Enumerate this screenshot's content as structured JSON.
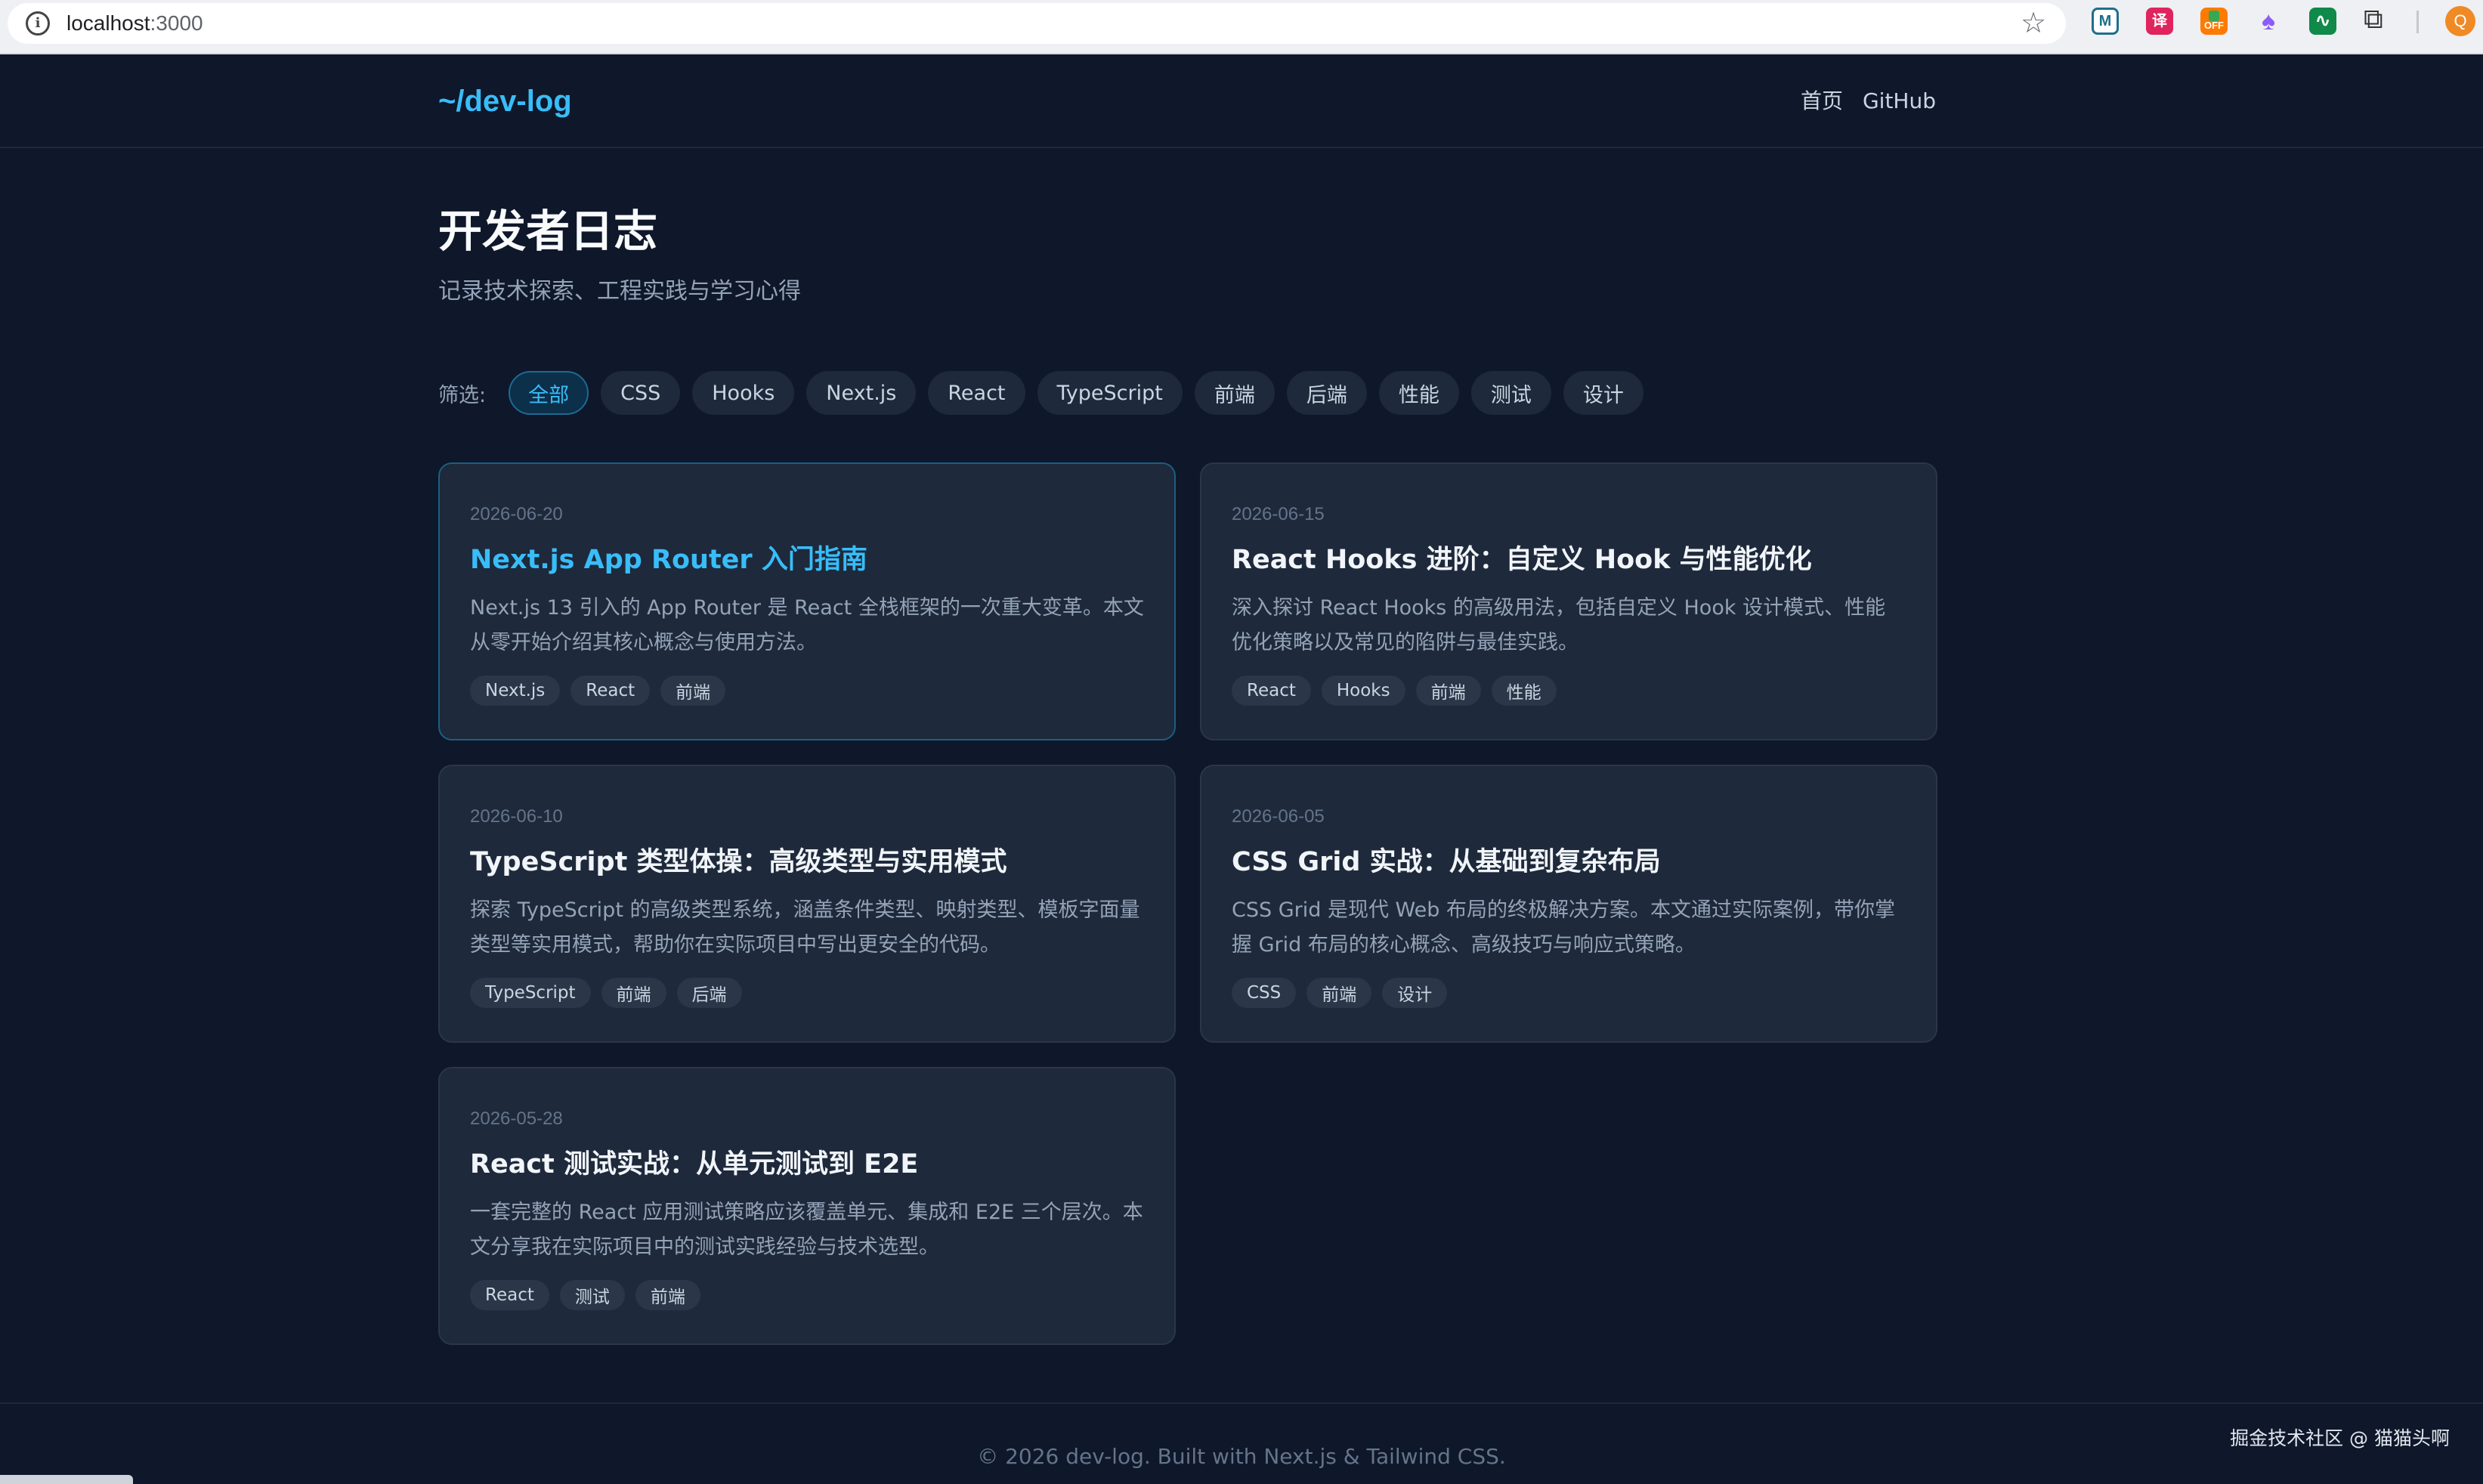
{
  "browser": {
    "url_host": "localhost",
    "url_port": ":3000",
    "extensions": [
      "M",
      "译",
      "OFF",
      "♠",
      "∿"
    ],
    "profile_initial": "Q"
  },
  "header": {
    "logo": "~/dev-log",
    "nav": [
      "首页",
      "GitHub"
    ]
  },
  "hero": {
    "title": "开发者日志",
    "subtitle": "记录技术探索、工程实践与学习心得"
  },
  "filter": {
    "label": "筛选:",
    "chips": [
      "全部",
      "CSS",
      "Hooks",
      "Next.js",
      "React",
      "TypeScript",
      "前端",
      "后端",
      "性能",
      "测试",
      "设计"
    ],
    "active_index": 0
  },
  "posts": [
    {
      "date": "2026-06-20",
      "title": "Next.js App Router 入门指南",
      "desc": "Next.js 13 引入的 App Router 是 React 全栈框架的一次重大变革。本文从零开始介绍其核心概念与使用方法。",
      "tags": [
        "Next.js",
        "React",
        "前端"
      ]
    },
    {
      "date": "2026-06-15",
      "title": "React Hooks 进阶：自定义 Hook 与性能优化",
      "desc": "深入探讨 React Hooks 的高级用法，包括自定义 Hook 设计模式、性能优化策略以及常见的陷阱与最佳实践。",
      "tags": [
        "React",
        "Hooks",
        "前端",
        "性能"
      ]
    },
    {
      "date": "2026-06-10",
      "title": "TypeScript 类型体操：高级类型与实用模式",
      "desc": "探索 TypeScript 的高级类型系统，涵盖条件类型、映射类型、模板字面量类型等实用模式，帮助你在实际项目中写出更安全的代码。",
      "tags": [
        "TypeScript",
        "前端",
        "后端"
      ]
    },
    {
      "date": "2026-06-05",
      "title": "CSS Grid 实战：从基础到复杂布局",
      "desc": "CSS Grid 是现代 Web 布局的终极解决方案。本文通过实际案例，带你掌握 Grid 布局的核心概念、高级技巧与响应式策略。",
      "tags": [
        "CSS",
        "前端",
        "设计"
      ]
    },
    {
      "date": "2026-05-28",
      "title": "React 测试实战：从单元测试到 E2E",
      "desc": "一套完整的 React 应用测试策略应该覆盖单元、集成和 E2E 三个层次。本文分享我在实际项目中的测试实践经验与技术选型。",
      "tags": [
        "React",
        "测试",
        "前端"
      ]
    }
  ],
  "footer": {
    "text": "© 2026 dev-log. Built with Next.js & Tailwind CSS.",
    "watermark": "掘金技术社区 @ 猫猫头啊"
  },
  "colors": {
    "background": "#0f172a",
    "card": "#1e293b",
    "accent": "#38bdf8",
    "muted": "#94a3b8"
  }
}
